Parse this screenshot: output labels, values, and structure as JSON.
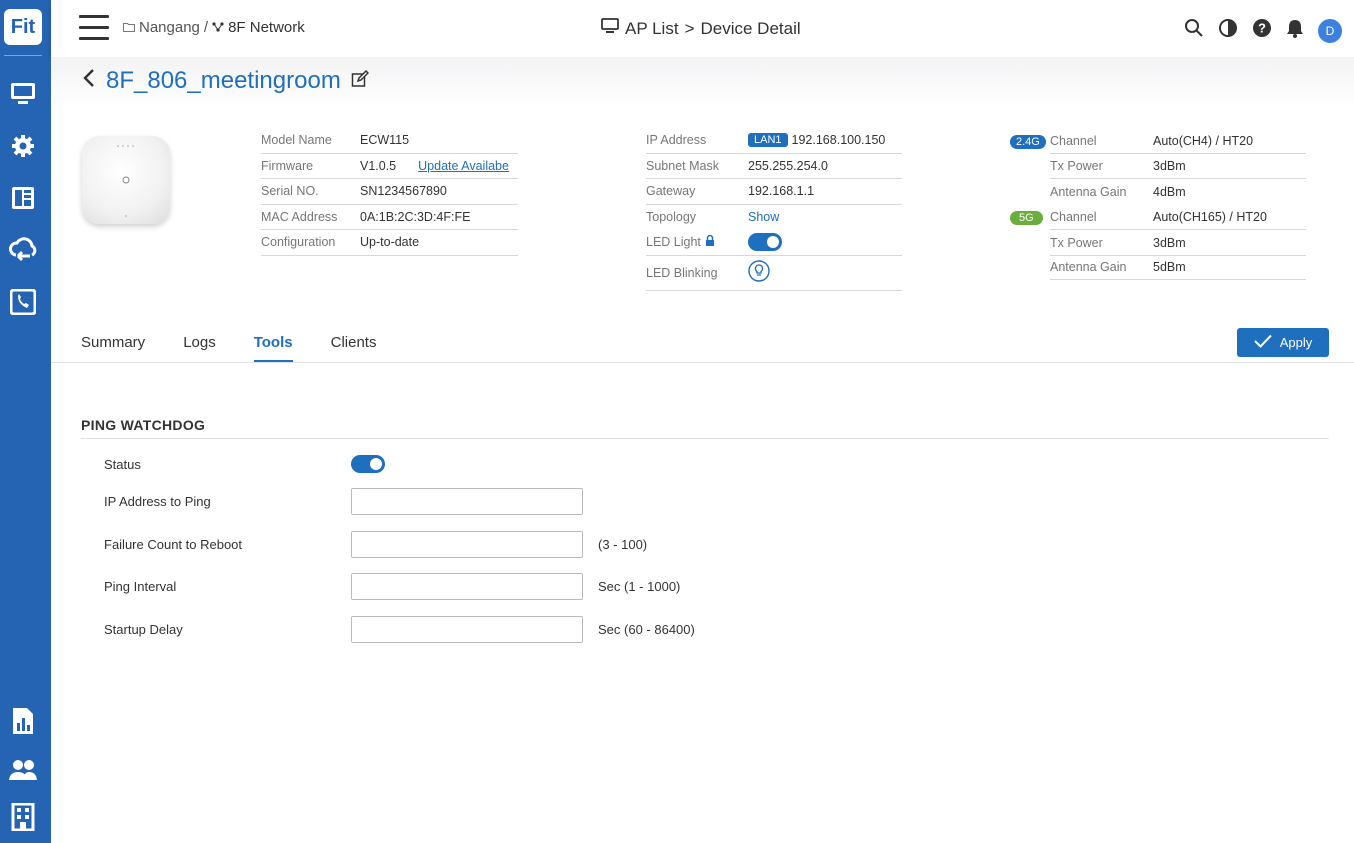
{
  "app": {
    "logo": "Fit"
  },
  "sidebar": {
    "top_icons": [
      "monitor-icon",
      "gear-icon",
      "dashboard-icon",
      "cloud-icon",
      "phone-icon"
    ],
    "bottom_icons": [
      "report-icon",
      "users-icon",
      "building-icon"
    ]
  },
  "topbar": {
    "breadcrumb_site": "Nangang",
    "breadcrumb_sep": "/",
    "breadcrumb_network": "8F Network",
    "title_part1": "AP List",
    "title_sep": ">",
    "title_part2": "Device Detail",
    "avatar_initial": "D"
  },
  "device": {
    "name": "8F_806_meetingroom",
    "col1": {
      "model_label": "Model Name",
      "model_value": "ECW115",
      "firmware_label": "Firmware",
      "firmware_value": "V1.0.5",
      "firmware_link": "Update Availabe",
      "serial_label": "Serial NO.",
      "serial_value": "SN1234567890",
      "mac_label": "MAC Address",
      "mac_value": "0A:1B:2C:3D:4F:FE",
      "config_label": "Configuration",
      "config_value": "Up-to-date"
    },
    "col2": {
      "ip_label": "IP Address",
      "ip_badge": "LAN1",
      "ip_value": "192.168.100.150",
      "subnet_label": "Subnet Mask",
      "subnet_value": "255.255.254.0",
      "gateway_label": "Gateway",
      "gateway_value": "192.168.1.1",
      "topology_label": "Topology",
      "topology_value": "Show",
      "led_light_label": "LED Light",
      "led_light_on": true,
      "led_blink_label": "LED Blinking"
    },
    "col3": {
      "band1": "2.4G",
      "band1_channel_label": "Channel",
      "band1_channel_value": "Auto(CH4) / HT20",
      "band1_tx_label": "Tx Power",
      "band1_tx_value": "3dBm",
      "band1_gain_label": "Antenna Gain",
      "band1_gain_value": "4dBm",
      "band2": "5G",
      "band2_channel_label": "Channel",
      "band2_channel_value": "Auto(CH165) / HT20",
      "band2_tx_label": "Tx Power",
      "band2_tx_value": "3dBm",
      "band2_gain_label": "Antenna Gain",
      "band2_gain_value": "5dBm"
    }
  },
  "tabs": {
    "summary": "Summary",
    "logs": "Logs",
    "tools": "Tools",
    "clients": "Clients",
    "active": "Tools"
  },
  "apply_label": "Apply",
  "ping_watchdog": {
    "title": "PING WATCHDOG",
    "status_label": "Status",
    "status_on": true,
    "ip_label": "IP Address to Ping",
    "ip_value": "",
    "failure_label": "Failure Count to Reboot",
    "failure_value": "",
    "failure_hint": "(3 - 100)",
    "interval_label": "Ping Interval",
    "interval_value": "",
    "interval_hint": "Sec (1 - 1000)",
    "delay_label": "Startup Delay",
    "delay_value": "",
    "delay_hint": "Sec (60 - 86400)"
  },
  "colors": {
    "sidebar": "#2563b3",
    "accent": "#1f6fbf",
    "band_24g": "#1f6fbf",
    "band_5g": "#6aae3b"
  }
}
